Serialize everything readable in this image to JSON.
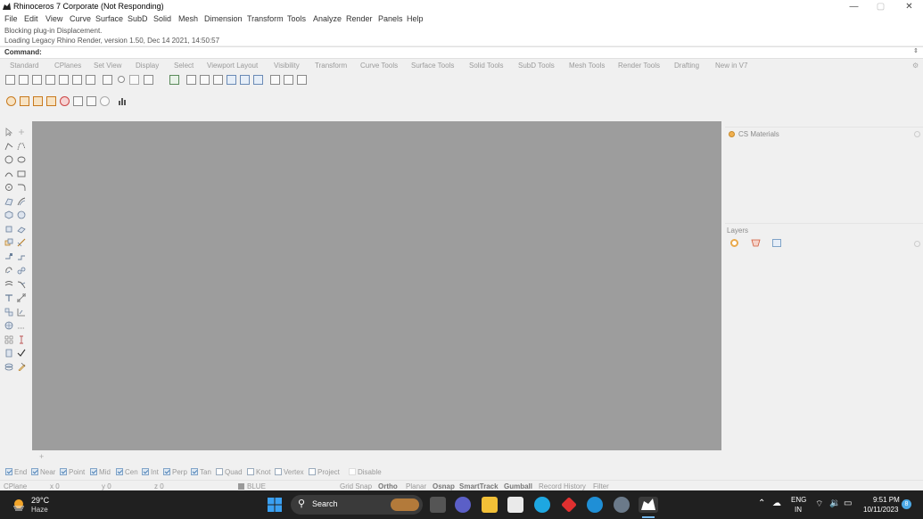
{
  "window": {
    "title": "Rhinoceros 7 Corporate (Not Responding)",
    "minimize": "—",
    "maximize": "▢",
    "close": "✕"
  },
  "menu": [
    "File",
    "Edit",
    "View",
    "Curve",
    "Surface",
    "SubD",
    "Solid",
    "Mesh",
    "Dimension",
    "Transform",
    "Tools",
    "Analyze",
    "Render",
    "Panels",
    "Help"
  ],
  "history": {
    "line1": "Blocking plug-in Displacement.",
    "line2": "Loading Legacy Rhino Render, version 1.50, Dec 14 2021, 14:50:57"
  },
  "command": {
    "label": "Command:",
    "value": ""
  },
  "tabs": [
    "Standard",
    "CPlanes",
    "Set View",
    "Display",
    "Select",
    "Viewport Layout",
    "Visibility",
    "Transform",
    "Curve Tools",
    "Surface Tools",
    "Solid Tools",
    "SubD Tools",
    "Mesh Tools",
    "Render Tools",
    "Drafting",
    "New in V7"
  ],
  "active_tab": "Viewport Layout",
  "panels": {
    "materials_title": "CS Materials",
    "layers_title": "Layers"
  },
  "osnap": [
    {
      "label": "End",
      "checked": true
    },
    {
      "label": "Near",
      "checked": true
    },
    {
      "label": "Point",
      "checked": true
    },
    {
      "label": "Mid",
      "checked": true
    },
    {
      "label": "Cen",
      "checked": true
    },
    {
      "label": "Int",
      "checked": true
    },
    {
      "label": "Perp",
      "checked": true
    },
    {
      "label": "Tan",
      "checked": true
    },
    {
      "label": "Quad",
      "checked": false
    },
    {
      "label": "Knot",
      "checked": false
    },
    {
      "label": "Vertex",
      "checked": false
    },
    {
      "label": "Project",
      "checked": false
    },
    {
      "label": "Disable",
      "checked": false
    }
  ],
  "status": {
    "cplane": "CPlane",
    "x": "x 0",
    "y": "y 0",
    "z": "z 0",
    "layer": "BLUE",
    "grid_snap": "Grid Snap",
    "ortho": "Ortho",
    "planar": "Planar",
    "osnap": "Osnap",
    "smarttrack": "SmartTrack",
    "gumball": "Gumball",
    "record_history": "Record History",
    "filter": "Filter"
  },
  "taskbar": {
    "temperature": "29°C",
    "weather": "Haze",
    "search": "Search",
    "lang1": "ENG",
    "lang2": "IN",
    "time": "9:51 PM",
    "date": "10/11/2023",
    "notifications": "8"
  },
  "colors": {
    "viewport": "#9d9d9d",
    "taskbar": "#202020",
    "accent": "#0078d4"
  }
}
